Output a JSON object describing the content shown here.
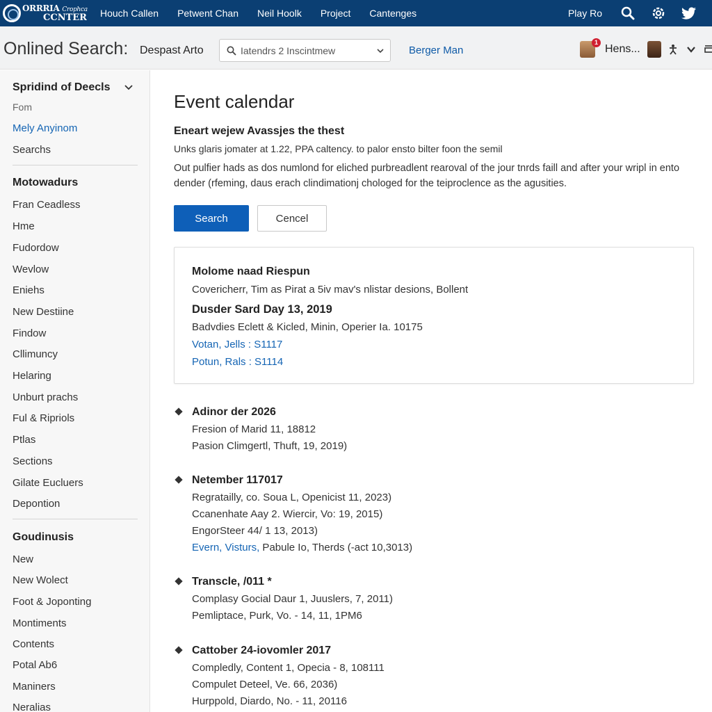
{
  "app": {
    "logo_line1": "ORRRIA",
    "logo_line1_small": "Crophca",
    "logo_line2": "CCNTER"
  },
  "topnav": {
    "links": [
      "Houch Callen",
      "Petwent Chan",
      "Neil Hoolk",
      "Project",
      "Cantenges"
    ],
    "play_label": "Play Ro",
    "icons": [
      "search-icon",
      "settings-icon",
      "twitter-icon"
    ]
  },
  "subheader": {
    "title": "Onlined Search:",
    "filter_label": "Despast Arto",
    "search_placeholder": "Iatendrs 2 Inscintmew",
    "link": "Berger Man",
    "notification_count": "1",
    "user_name": "Hens..."
  },
  "sidebar": {
    "section1": {
      "title": "Spridind of Deecls",
      "items": [
        {
          "label": "Fom",
          "style": "muted"
        },
        {
          "label": "Mely Anyinom",
          "style": "link"
        },
        {
          "label": "Searchs",
          "style": "normal"
        }
      ]
    },
    "section2": {
      "title": "Motowadurs",
      "items": [
        "Fran Ceadless",
        "Hme",
        "Fudordow",
        "Wevlow",
        "Eniehs",
        "New Destiine",
        "Findow",
        "Cllimuncy",
        "Helaring",
        "Unburt prachs",
        "Ful & Ripriols",
        "Ptlas",
        "Sections",
        "Gilate Eucluers",
        "Depontion"
      ]
    },
    "section3": {
      "title": "Goudinusis",
      "items": [
        "New",
        "New Wolect",
        "Foot & Joponting",
        "Montiments",
        "Contents",
        "Potal Ab6",
        "Maniners",
        "Neralias"
      ]
    }
  },
  "main": {
    "title": "Event calendar",
    "subhead": "Eneart wejew Avassjes the thest",
    "para1": "Unks glaris jomater at 1.22, PPA caltency. to palor ensto bilter foon the semil",
    "para2": "Out pulfier hads as dos numlond for eliched purbreadlent rearoval of the jour tnrds faill and after your wripl in ento dender (rfeming, daus erach clindimationj chologed for the teiproclence as the agusities.",
    "search_button": "Search",
    "cancel_button": "Cencel",
    "card": {
      "title": "Molome naad Riespun",
      "subtitle": "Covericherr, Tim as Pirat a 5iv mav's nlistar desions, Bollent",
      "date": "Dusder Sard Day 13, 2019",
      "details": "Badvdies Eclett & Kicled, Minin, Operier Ia. 10175",
      "links": [
        "Votan, Jells : S1117",
        "Potun, Rals : S1114"
      ]
    },
    "events": [
      {
        "heading": "Adinor der 2026",
        "lines": [
          {
            "text": "Fresion of Marid 11, 18812"
          },
          {
            "text": "Pasion Climgertl, Thuft, 19, 2019)"
          }
        ]
      },
      {
        "heading": "Netember 117017",
        "lines": [
          {
            "text": "Regratailly, co. Soua L, Openicist 11, 2023)"
          },
          {
            "text": "Ccanenhate Aay 2. Wiercir, Vo: 19, 2015)"
          },
          {
            "text": "EngorSteer 44/ 1 13, 2013)"
          },
          {
            "link": "Evern, Visturs,",
            "text": " Pabule Io, Therds (-act 10,3013)"
          }
        ]
      },
      {
        "heading": "Transcle, /011 *",
        "lines": [
          {
            "text": "Complasy Gocial Daur 1, Juuslers, 7, 2011)"
          },
          {
            "text": "Pemliptace, Purk, Vo. - 14, 11, 1PM6"
          }
        ]
      },
      {
        "heading": "Cattober 24-iovomler 2017",
        "lines": [
          {
            "text": "Compledly, Content 1, Opecia - 8, 108111"
          },
          {
            "text": "Compulet Deteel, Ve. 66, 2036)"
          },
          {
            "text": "Hurppold, Diardo, No. - 11, 20116"
          }
        ]
      }
    ]
  },
  "colors": {
    "topnav_bg": "#0b3f73",
    "primary_button": "#0e5fb8",
    "link": "#1565b4",
    "badge": "#d02030"
  }
}
